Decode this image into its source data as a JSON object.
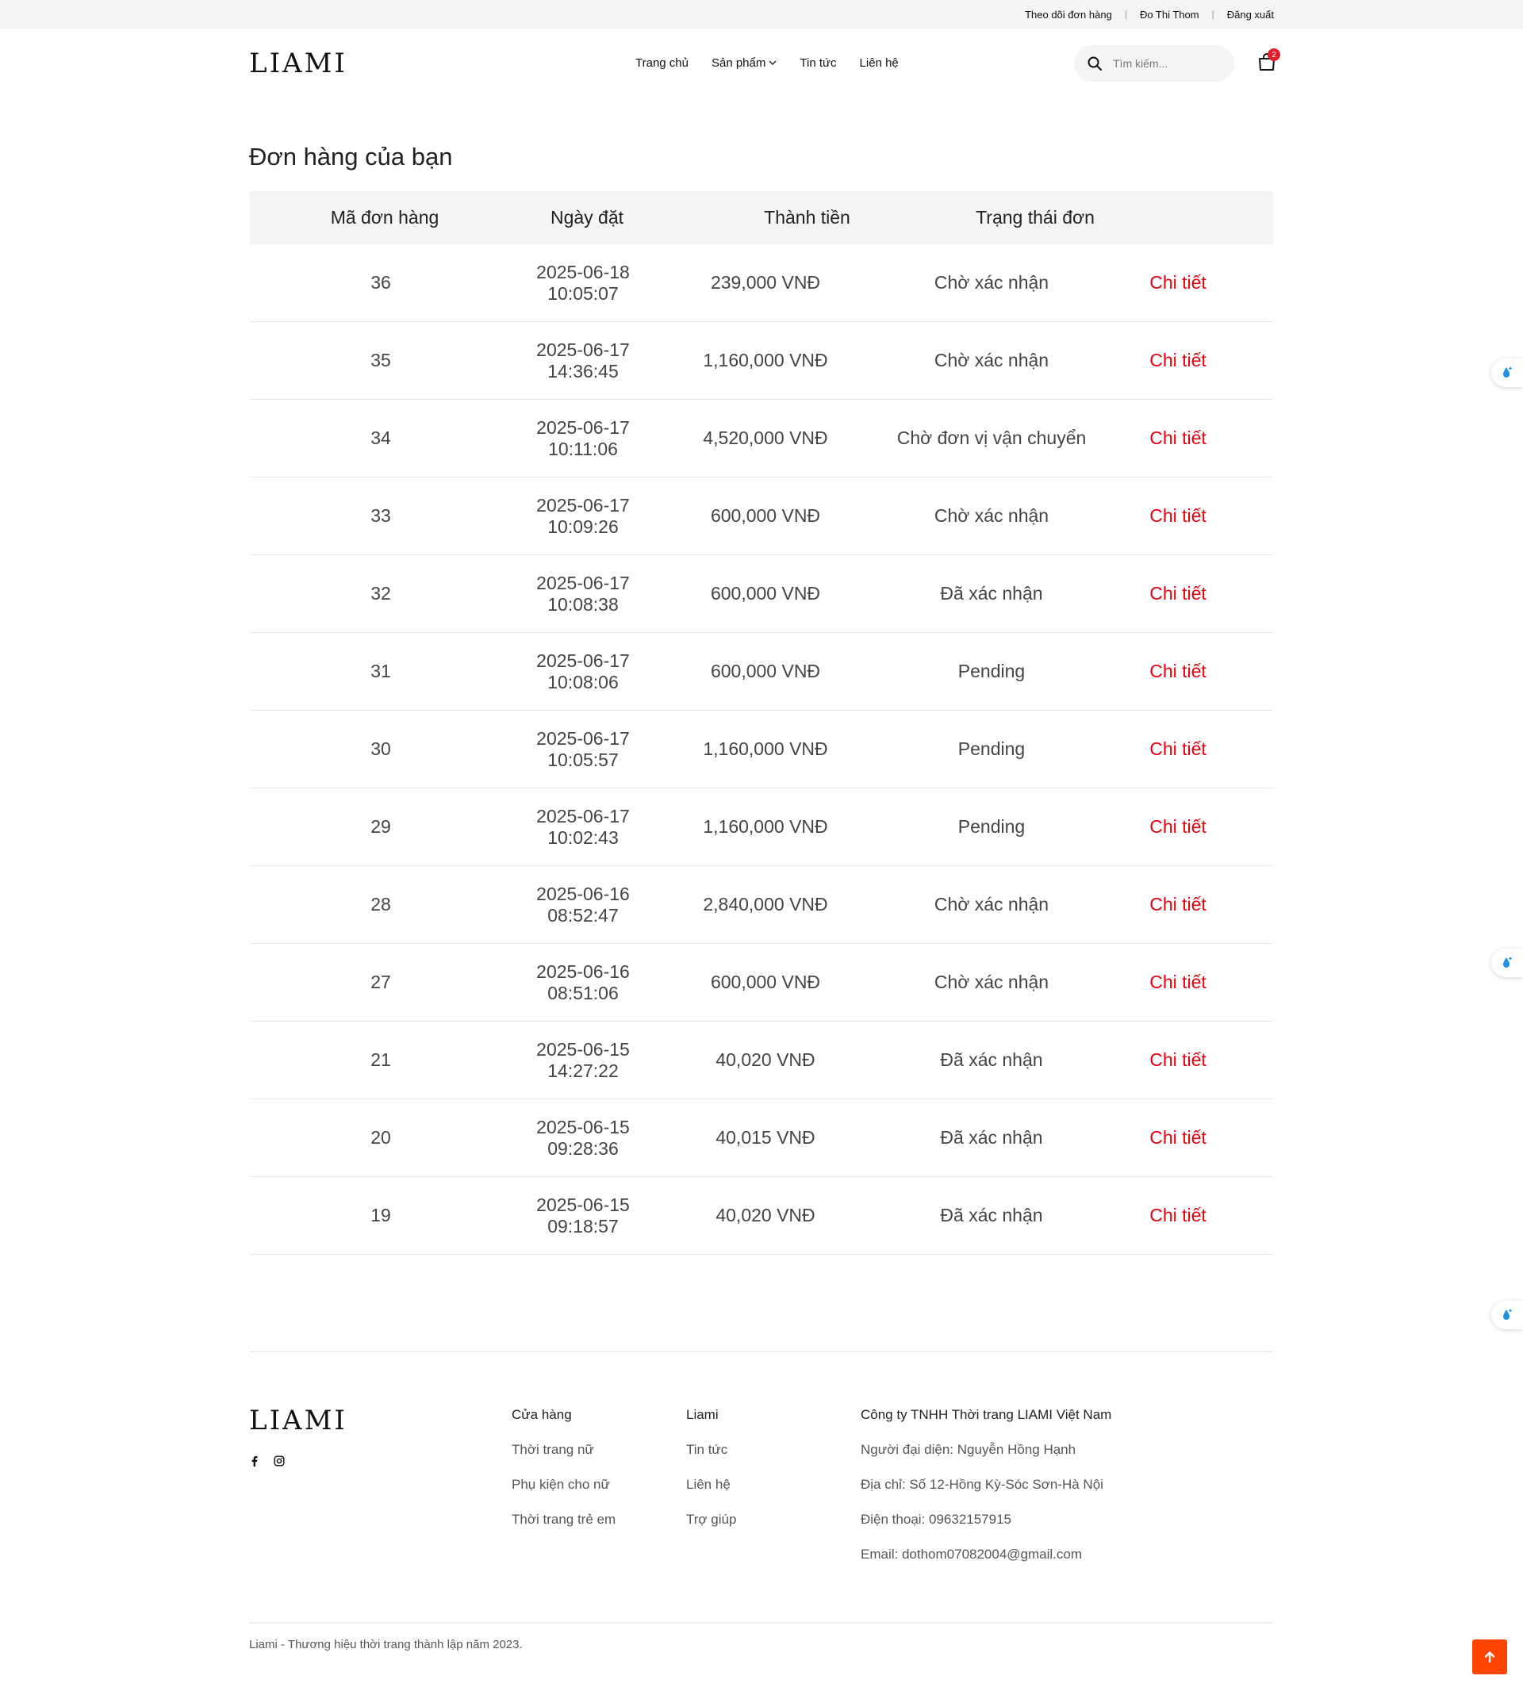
{
  "topbar": {
    "links": [
      "Theo dõi đơn hàng",
      "Đo Thi Thom",
      "Đăng xuất"
    ]
  },
  "header": {
    "logo": "LIAMI",
    "nav": [
      "Trang chủ",
      "Sản phẩm",
      "Tin tức",
      "Liên hệ"
    ],
    "search_placeholder": "Tìm kiếm...",
    "cart_count": "2"
  },
  "page": {
    "title": "Đơn hàng của bạn"
  },
  "table": {
    "headers": [
      "Mã đơn hàng",
      "Ngày đặt",
      "Thành tiền",
      "Trạng thái đơn"
    ],
    "rows": [
      {
        "id": "36",
        "date": "2025-06-18 10:05:07",
        "total": "239,000 VNĐ",
        "status": "Chờ xác nhận",
        "action": "Chi tiết"
      },
      {
        "id": "35",
        "date": "2025-06-17 14:36:45",
        "total": "1,160,000 VNĐ",
        "status": "Chờ xác nhận",
        "action": "Chi tiết"
      },
      {
        "id": "34",
        "date": "2025-06-17 10:11:06",
        "total": "4,520,000 VNĐ",
        "status": "Chờ đơn vị vận chuyển",
        "action": "Chi tiết"
      },
      {
        "id": "33",
        "date": "2025-06-17 10:09:26",
        "total": "600,000 VNĐ",
        "status": "Chờ xác nhận",
        "action": "Chi tiết"
      },
      {
        "id": "32",
        "date": "2025-06-17 10:08:38",
        "total": "600,000 VNĐ",
        "status": "Đã xác nhận",
        "action": "Chi tiết"
      },
      {
        "id": "31",
        "date": "2025-06-17 10:08:06",
        "total": "600,000 VNĐ",
        "status": "Pending",
        "action": "Chi tiết"
      },
      {
        "id": "30",
        "date": "2025-06-17 10:05:57",
        "total": "1,160,000 VNĐ",
        "status": "Pending",
        "action": "Chi tiết"
      },
      {
        "id": "29",
        "date": "2025-06-17 10:02:43",
        "total": "1,160,000 VNĐ",
        "status": "Pending",
        "action": "Chi tiết"
      },
      {
        "id": "28",
        "date": "2025-06-16 08:52:47",
        "total": "2,840,000 VNĐ",
        "status": "Chờ xác nhận",
        "action": "Chi tiết"
      },
      {
        "id": "27",
        "date": "2025-06-16 08:51:06",
        "total": "600,000 VNĐ",
        "status": "Chờ xác nhận",
        "action": "Chi tiết"
      },
      {
        "id": "21",
        "date": "2025-06-15 14:27:22",
        "total": "40,020 VNĐ",
        "status": "Đã xác nhận",
        "action": "Chi tiết"
      },
      {
        "id": "20",
        "date": "2025-06-15 09:28:36",
        "total": "40,015 VNĐ",
        "status": "Đã xác nhận",
        "action": "Chi tiết"
      },
      {
        "id": "19",
        "date": "2025-06-15 09:18:57",
        "total": "40,020 VNĐ",
        "status": "Đã xác nhận",
        "action": "Chi tiết"
      }
    ]
  },
  "footer": {
    "logo": "LIAMI",
    "social_icons": [
      "facebook-icon",
      "instagram-icon"
    ],
    "col1": {
      "title": "Cửa hàng",
      "links": [
        "Thời trang nữ",
        "Phụ kiện cho nữ",
        "Thời trang trẻ em"
      ]
    },
    "col2": {
      "title": "Liami",
      "links": [
        "Tin tức",
        "Liên hệ",
        "Trợ giúp"
      ]
    },
    "col3": {
      "title": "Công ty TNHH Thời trang LIAMI Việt Nam",
      "lines": [
        "Người đại diện: Nguyễn Hồng Hạnh",
        "Địa chỉ: Số 12-Hồng Kỳ-Sóc Sơn-Hà Nội",
        "Điện thoại: 09632157915",
        "Email: dothom07082004@gmail.com"
      ]
    },
    "copyright": "Liami - Thương hiệu thời trang thành lập năm 2023."
  },
  "colors": {
    "accent": "#e8000d",
    "scroll_top": "#ff4400",
    "header_bg": "#f3f4f6"
  }
}
